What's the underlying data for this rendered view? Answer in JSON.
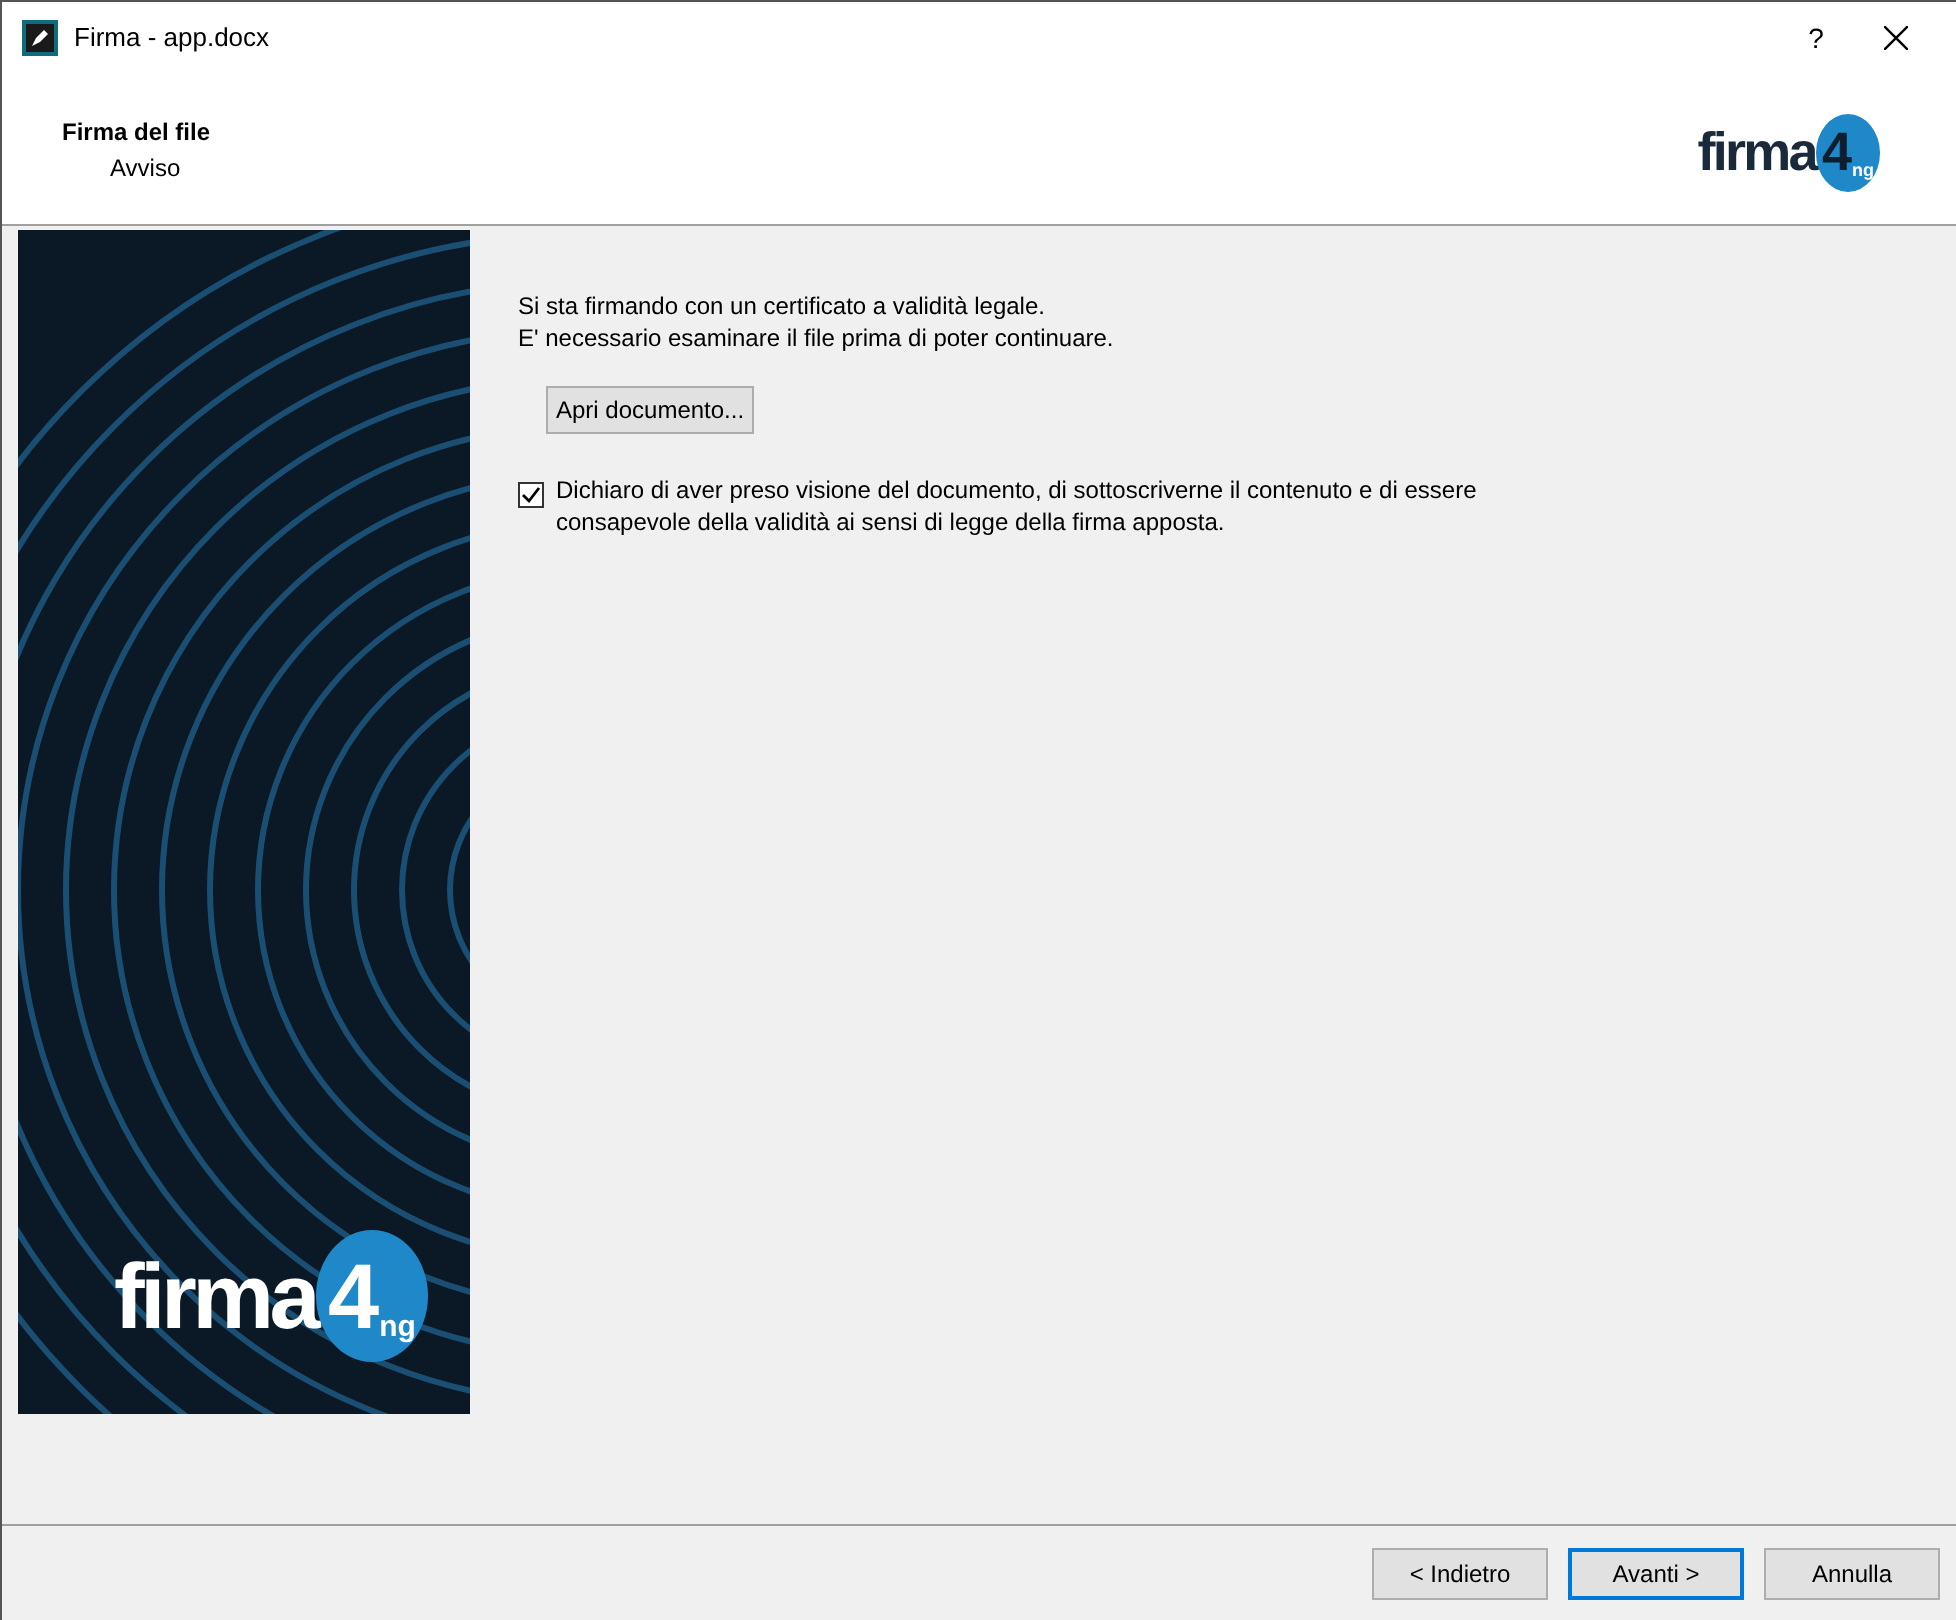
{
  "window": {
    "title": "Firma - app.docx",
    "help": "?"
  },
  "header": {
    "title": "Firma del file",
    "subtitle": "Avviso",
    "logo": {
      "word": "firma",
      "digit": "4",
      "suffix": "ng"
    }
  },
  "side_banner": {
    "logo": {
      "word": "firma",
      "digit": "4",
      "suffix": "ng"
    }
  },
  "content": {
    "message": [
      "Si sta firmando con un certificato a validità legale.",
      "E' necessario esaminare il file prima di poter continuare."
    ],
    "open_button": "Apri documento...",
    "declaration": {
      "label": "Dichiaro di aver preso visione del documento, di sottoscriverne il contenuto e di essere consapevole della validità ai sensi di legge della firma apposta.",
      "checked": true
    }
  },
  "buttons": [
    {
      "label": "< Indietro",
      "default": false
    },
    {
      "label": "Avanti >",
      "default": true
    },
    {
      "label": "Annulla",
      "default": false
    }
  ]
}
